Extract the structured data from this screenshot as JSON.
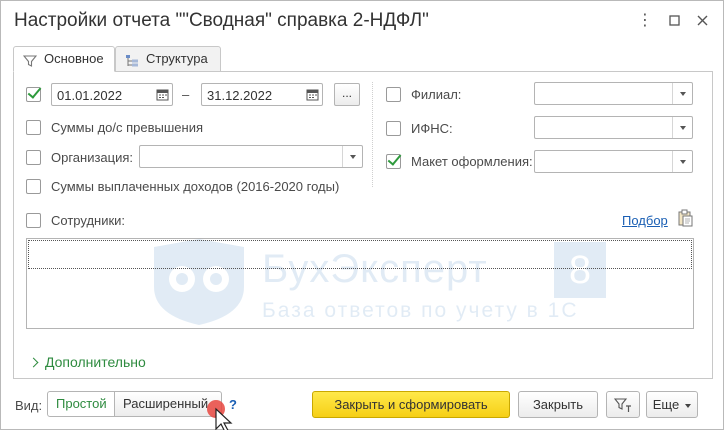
{
  "window": {
    "title": "Настройки отчета \"\"Сводная\" справка 2-НДФЛ\"",
    "controls": [
      "more-icon",
      "maximize-icon",
      "close-icon"
    ]
  },
  "tabs": [
    {
      "label": "Основное",
      "icon": "filter-icon",
      "active": true
    },
    {
      "label": "Структура",
      "icon": "structure-icon",
      "active": false
    }
  ],
  "period": {
    "checked": true,
    "from": "01.01.2022",
    "separator": "–",
    "to": "31.12.2022",
    "dots_label": "..."
  },
  "left_options": [
    {
      "label": "Суммы до/с превышения",
      "checked": false
    },
    {
      "label": "Организация:",
      "checked": false,
      "value": ""
    },
    {
      "label": "Суммы выплаченных доходов (2016-2020 годы)",
      "checked": false
    }
  ],
  "right_options": [
    {
      "label": "Филиал:",
      "checked": false,
      "value": ""
    },
    {
      "label": "ИФНС:",
      "checked": false,
      "value": ""
    },
    {
      "label": "Макет оформления:",
      "checked": true,
      "value": ""
    }
  ],
  "employees": {
    "label": "Сотрудники:",
    "checked": false,
    "pick_link": "Подбор",
    "paste_icon": "paste-icon",
    "rows": []
  },
  "additional": {
    "label": "Дополнительно"
  },
  "watermark": {
    "brand": "БухЭксперт",
    "brand_digit": "8",
    "tagline": "База ответов по учету в 1С"
  },
  "footer": {
    "view_label": "Вид:",
    "view_simple": "Простой",
    "view_extended": "Расширенный",
    "help": "?",
    "generate_button": "Закрыть и сформировать",
    "close_button": "Закрыть",
    "filter_icon": "filter-t-icon",
    "more_button": "Еще"
  },
  "colors": {
    "accent_green": "#2e8b3f",
    "primary_yellow": "#f6cf16",
    "link_blue": "#1a5fb4"
  }
}
